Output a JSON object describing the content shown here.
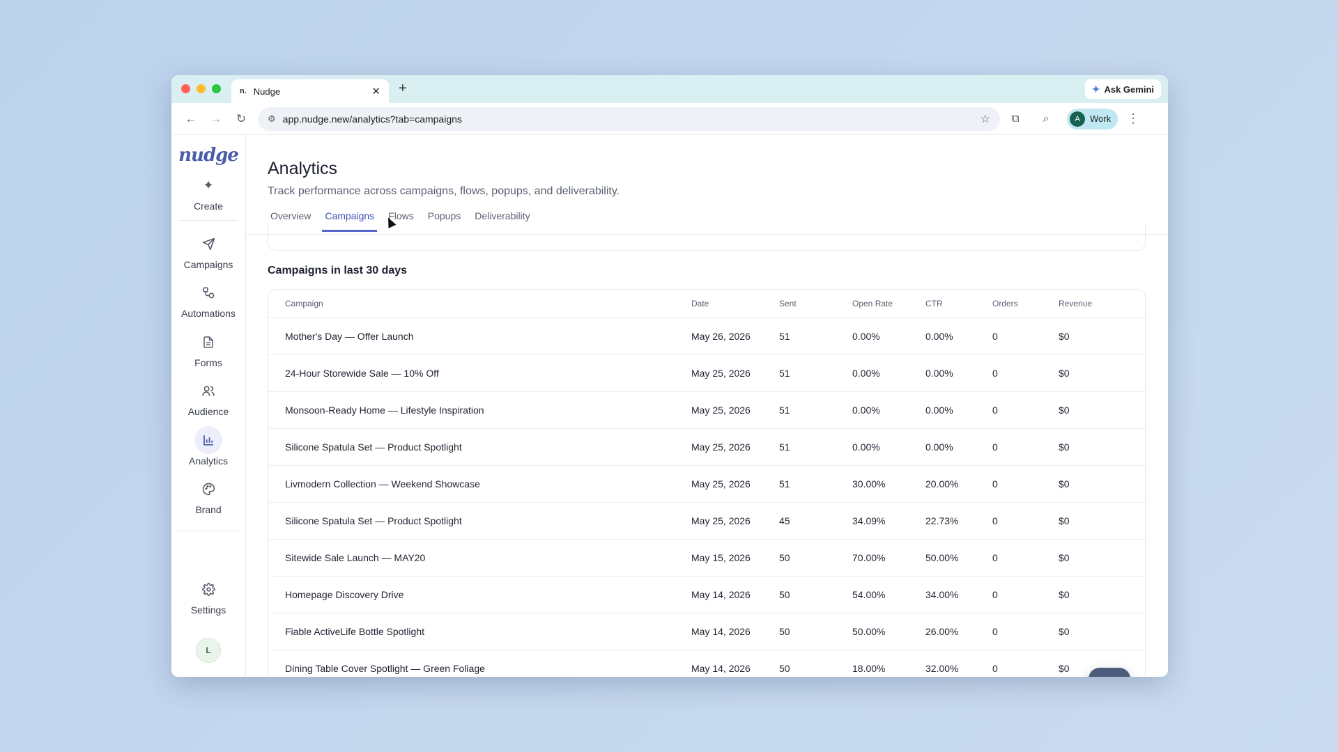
{
  "browser": {
    "tab_title": "Nudge",
    "tab_favicon": "n.",
    "url": "app.nudge.new/analytics?tab=campaigns",
    "gemini_label": "Ask Gemini",
    "profile_initial": "A",
    "profile_label": "Work"
  },
  "sidebar": {
    "logo": "nudge",
    "items": [
      {
        "label": "Create",
        "icon": "plus-icon"
      },
      {
        "label": "Campaigns",
        "icon": "send-icon"
      },
      {
        "label": "Automations",
        "icon": "workflow-icon"
      },
      {
        "label": "Forms",
        "icon": "document-icon"
      },
      {
        "label": "Audience",
        "icon": "users-icon"
      },
      {
        "label": "Analytics",
        "icon": "bar-chart-icon"
      },
      {
        "label": "Brand",
        "icon": "palette-icon"
      },
      {
        "label": "Settings",
        "icon": "gear-icon"
      }
    ],
    "user_initial": "L"
  },
  "page": {
    "title": "Analytics",
    "subtitle": "Track performance across campaigns, flows, popups, and deliverability.",
    "tabs": [
      "Overview",
      "Campaigns",
      "Flows",
      "Popups",
      "Deliverability"
    ],
    "active_tab": "Campaigns",
    "section_title": "Campaigns in last 30 days"
  },
  "table": {
    "headers": [
      "Campaign",
      "Date",
      "Sent",
      "Open Rate",
      "CTR",
      "Orders",
      "Revenue"
    ],
    "rows": [
      [
        "Mother's Day — Offer Launch",
        "May 26, 2026",
        "51",
        "0.00%",
        "0.00%",
        "0",
        "$0"
      ],
      [
        "24-Hour Storewide Sale — 10% Off",
        "May 25, 2026",
        "51",
        "0.00%",
        "0.00%",
        "0",
        "$0"
      ],
      [
        "Monsoon-Ready Home — Lifestyle Inspiration",
        "May 25, 2026",
        "51",
        "0.00%",
        "0.00%",
        "0",
        "$0"
      ],
      [
        "Silicone Spatula Set — Product Spotlight",
        "May 25, 2026",
        "51",
        "0.00%",
        "0.00%",
        "0",
        "$0"
      ],
      [
        "Livmodern Collection — Weekend Showcase",
        "May 25, 2026",
        "51",
        "30.00%",
        "20.00%",
        "0",
        "$0"
      ],
      [
        "Silicone Spatula Set — Product Spotlight",
        "May 25, 2026",
        "45",
        "34.09%",
        "22.73%",
        "0",
        "$0"
      ],
      [
        "Sitewide Sale Launch — MAY20",
        "May 15, 2026",
        "50",
        "70.00%",
        "50.00%",
        "0",
        "$0"
      ],
      [
        "Homepage Discovery Drive",
        "May 14, 2026",
        "50",
        "54.00%",
        "34.00%",
        "0",
        "$0"
      ],
      [
        "Fiable ActiveLife Bottle Spotlight",
        "May 14, 2026",
        "50",
        "50.00%",
        "26.00%",
        "0",
        "$0"
      ],
      [
        "Dining Table Cover Spotlight — Green Foliage",
        "May 14, 2026",
        "50",
        "18.00%",
        "32.00%",
        "0",
        "$0"
      ]
    ]
  },
  "colors": {
    "accent": "#3f51b5",
    "chat_fab": "#4d5b7c"
  }
}
